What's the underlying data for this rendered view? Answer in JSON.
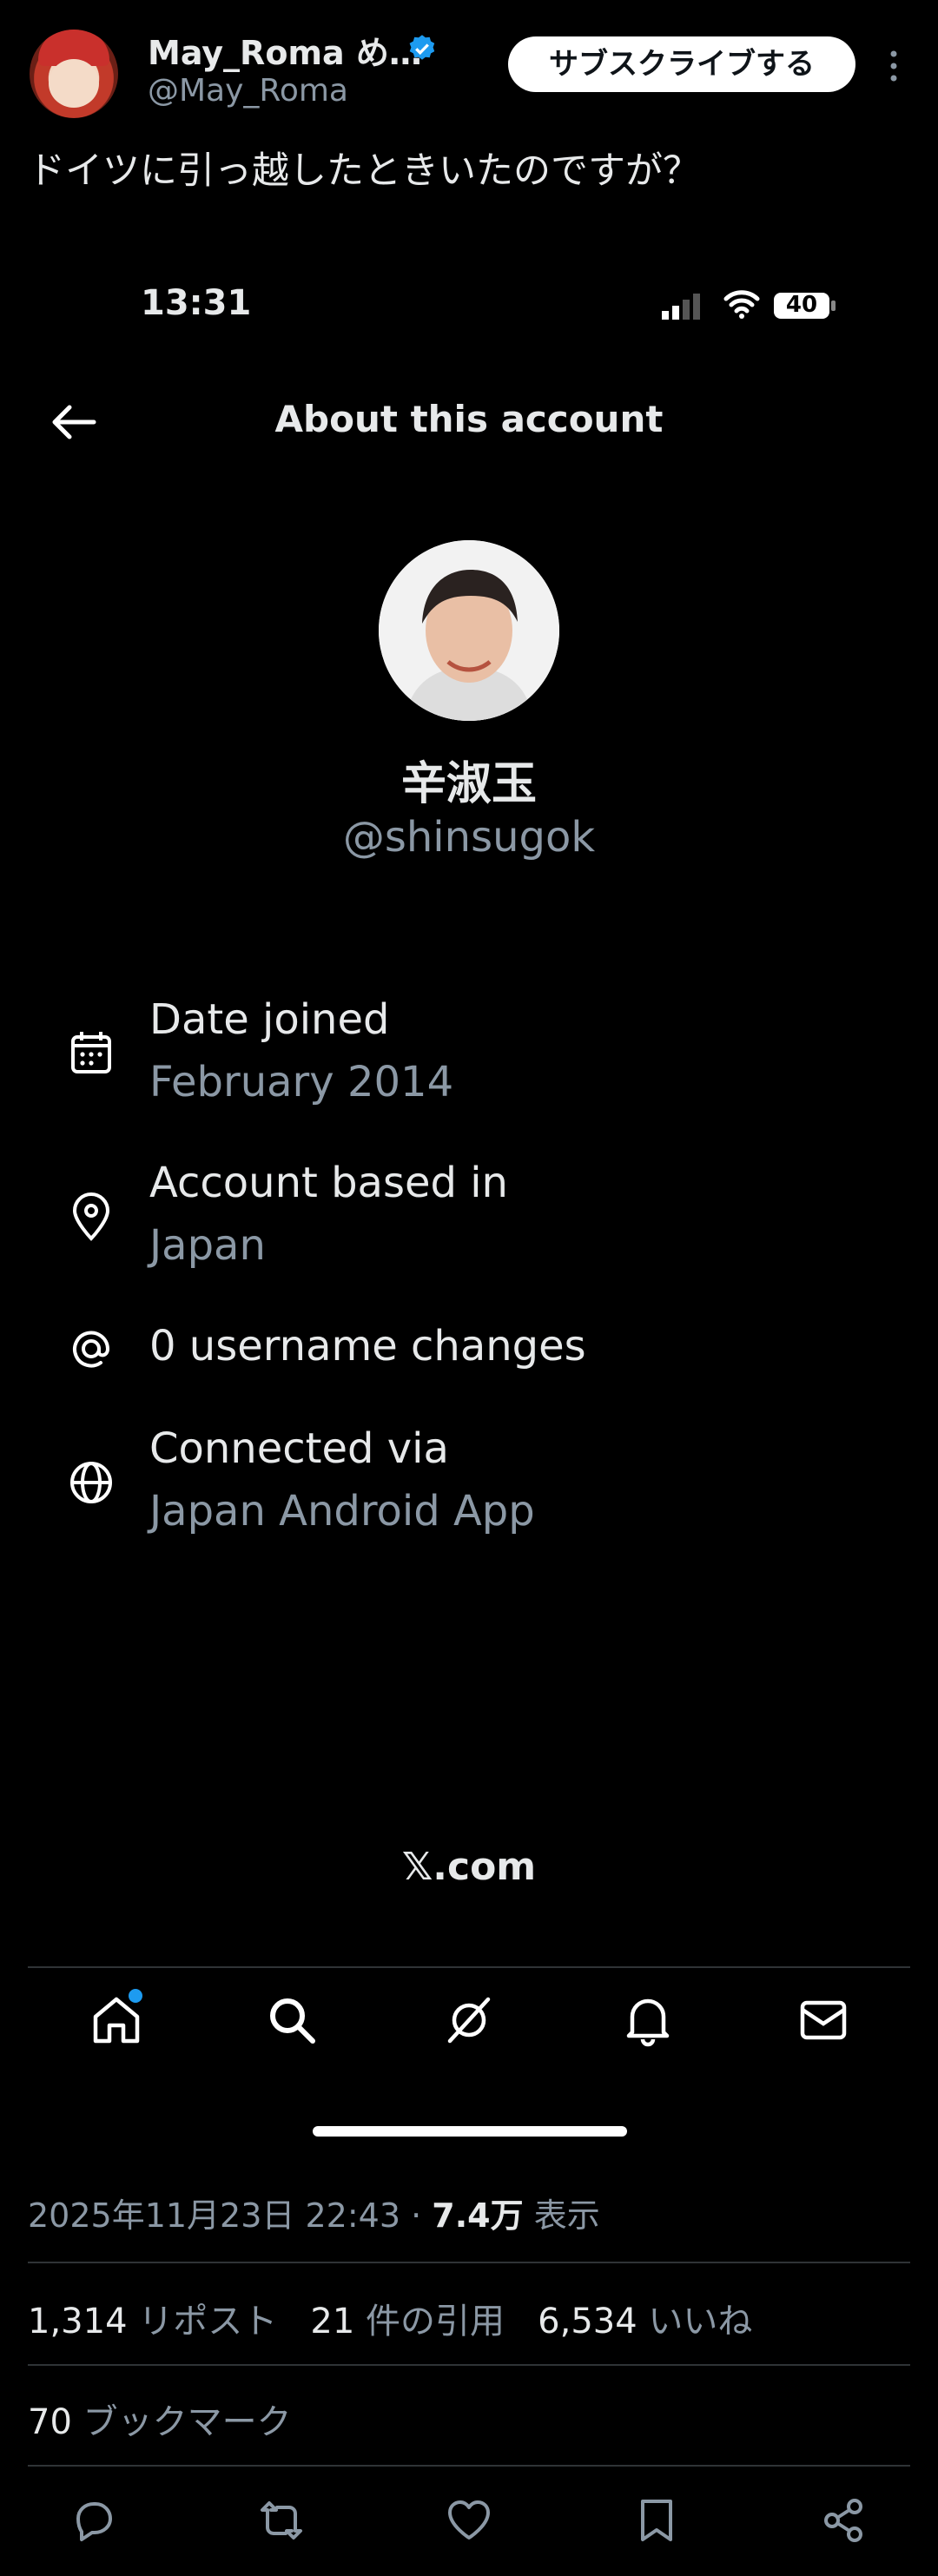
{
  "tweet": {
    "author_name": "May_Roma め…",
    "author_handle": "@May_Roma",
    "subscribe_label": "サブスクライブする",
    "text": "ドイツに引っ越したときいたのですが？"
  },
  "screenshot": {
    "status_time": "13:31",
    "battery": "40",
    "title": "About this account",
    "profile_name": "辛淑玉",
    "profile_handle": "@shinsugok",
    "details": [
      {
        "icon": "calendar-icon",
        "label": "Date joined",
        "value": "February 2014"
      },
      {
        "icon": "location-pin-icon",
        "label": "Account based in",
        "value": "Japan"
      },
      {
        "icon": "at-sign-icon",
        "label": "0 username changes",
        "value": ""
      },
      {
        "icon": "globe-icon",
        "label": "Connected via",
        "value": "Japan Android App"
      }
    ],
    "footer_brand": "𝕏.com",
    "nav": [
      "home-icon",
      "search-icon",
      "grok-icon",
      "bell-icon",
      "mail-icon"
    ]
  },
  "meta": {
    "datetime": "2025年11月23日 22:43",
    "views_count": "7.4万",
    "views_label": "表示"
  },
  "stats": {
    "reposts_count": "1,314",
    "reposts_label": "リポスト",
    "quotes_count": "21",
    "quotes_label": "件の引用",
    "likes_count": "6,534",
    "likes_label": "いいね",
    "bookmarks_count": "70",
    "bookmarks_label": "ブックマーク"
  },
  "colors": {
    "background": "#000000",
    "muted_text": "#8b98a5",
    "accent": "#1d9bf0",
    "divider": "#2f3336"
  }
}
